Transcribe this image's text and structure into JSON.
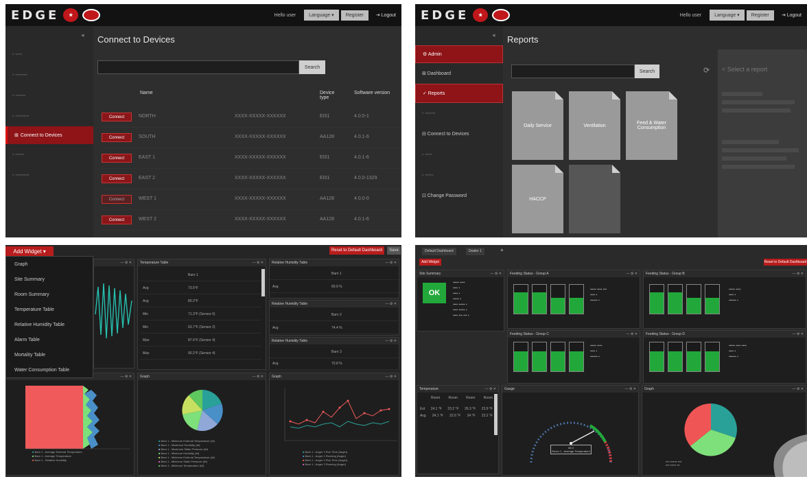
{
  "connect": {
    "topbar": {
      "brand": "EDGE",
      "hello": "Hello user",
      "language": "Language ▾",
      "register": "Register",
      "logout": "⇥ Logout"
    },
    "sidebar_active": "Connect to Devices",
    "title": "Connect to Devices",
    "search_button": "Search",
    "headers": {
      "name": "Name",
      "device_type": "Device type",
      "software_version": "Software version"
    },
    "connect_label": "Connect",
    "rows": [
      {
        "name": "NORTH",
        "serial": "XXXX-XXXXX-XXXXXX",
        "type": "EI01",
        "version": "4.0.0-1"
      },
      {
        "name": "SOUTH",
        "serial": "XXXX-XXXXX-XXXXXX",
        "type": "AA128",
        "version": "4.0.1-6"
      },
      {
        "name": "EAST 1",
        "serial": "XXXX-XXXXX-XXXXXX",
        "type": "EI01",
        "version": "4.0.1-6"
      },
      {
        "name": "EAST 2",
        "serial": "XXXX-XXXXX-XXXXXX",
        "type": "EI01",
        "version": "4.0.0-1329"
      },
      {
        "name": "WEST 1",
        "serial": "XXXX-XXXXX-XXXXXX",
        "type": "AA128",
        "version": "4.0.0-0"
      },
      {
        "name": "WEST 2",
        "serial": "XXXX-XXXXX-XXXXXX",
        "type": "AA128",
        "version": "4.0.1-6"
      }
    ]
  },
  "reports": {
    "topbar": {
      "brand": "EDGE",
      "hello": "Hello user",
      "language": "Language ▾",
      "register": "Register",
      "logout": "⇥ Logout"
    },
    "sidebar": {
      "admin": "⚙ Admin",
      "dashboard": "⊞ Dashboard",
      "reports": "✓ Reports",
      "connect": "⊟ Connect to Devices",
      "change_password": "⊡ Change Password"
    },
    "title": "Reports",
    "search_button": "Search",
    "tiles": [
      "Daily Service",
      "Ventilation",
      "Feed & Water Consumption",
      "HACCP"
    ],
    "select_report": "< Select a report"
  },
  "dashboard_widgets": {
    "add_widget": "Add Widget ▾",
    "reset": "Reset to Default Dashboard",
    "save": "Save",
    "menu_items": [
      "Graph",
      "Site Summary",
      "Room Summary",
      "Temperature Table",
      "Relative Humidity Table",
      "Alarm Table",
      "Mortality Table",
      "Water Consumption Table"
    ],
    "panel_titles": {
      "temp_table": "Temperature Table",
      "humidity_table": "Relative Humidity Table",
      "graph": "Graph"
    },
    "temp_rows": [
      {
        "label": "Barn 1",
        "value": ""
      },
      {
        "label": "Avg",
        "value": "73.5°F"
      },
      {
        "label": "Avg",
        "value": "80.2°F"
      },
      {
        "label": "Min",
        "value": "71.3°F (Sensor 6)"
      },
      {
        "label": "Min",
        "value": "63.7°F (Sensor 2)"
      },
      {
        "label": "Max",
        "value": "87.6°F (Sensor 4)"
      },
      {
        "label": "Max",
        "value": "90.2°F (Sensor 4)"
      }
    ],
    "humidity_rows": [
      {
        "label": "Barn 1",
        "value": ""
      },
      {
        "label": "Avg",
        "value": "60.9 %"
      },
      {
        "label": "Barn 2",
        "value": ""
      },
      {
        "label": "Avg",
        "value": "74.4 %"
      },
      {
        "label": "Barn 3",
        "value": ""
      },
      {
        "label": "Avg",
        "value": "70.8 %"
      }
    ],
    "pie_legend": [
      "Barn 1 - Minimum External Temperature (Af)",
      "Barn 1 - Maximum Humidity (Af)",
      "Barn 1 - Maximum Static Pressure (Af)",
      "Barn 1 - Minimum Humidity (Af)",
      "Barn 1 - Minimum External Temperature (Af)",
      "Barn 1 - Minimum Static Pressure (Af)",
      "Barn 1 - Minimum Temperature (Af)"
    ],
    "line_legend": [
      "Barn 1 - Auger 1 Run Time (Auger)",
      "Barn 1 - Auger 1 Running (Auger)",
      "Barn 1 - Auger 2 Run Time (Auger)",
      "Barn 1 - Auger 2 Running (Auger)"
    ],
    "stacked_legend": [
      "Barn 1 - Average External Temperature",
      "Barn 1 - Average Temperature",
      "Barn 1 - Relative Humidity"
    ]
  },
  "dashboard_status": {
    "tab": "Default Dashboard",
    "tab2": "Dealer 1",
    "add_tab": "+",
    "add_widget": "Add Widget",
    "reset": "Reset to Default Dashboard",
    "ok": "OK",
    "panels": [
      "Site Summary",
      "Feeding Status - Group A",
      "Feeding Status - Group B",
      "Feeding Status - Group C",
      "Feeding Status - Group D",
      "Temperature",
      "Gauge",
      "Graph"
    ],
    "temp_headers": [
      "Room",
      "Room",
      "Room",
      "Room"
    ],
    "temp_rows": [
      {
        "label": "Ext",
        "values": [
          "24.1 °F",
          "23.2 °F",
          "26.3 °F",
          "23.9 °F"
        ]
      },
      {
        "label": "Avg",
        "values": [
          "24.1 °F",
          "22.6 °F",
          "24 °F",
          "23.2 °F"
        ]
      }
    ],
    "gauge_value": "68.3",
    "gauge_label": "Room 1 - Average Temperature"
  },
  "colors": {
    "accent_red": "#8e1418",
    "ok_green": "#22a83a",
    "pie": [
      "#2aa198",
      "#f05555",
      "#7ee07a"
    ]
  }
}
